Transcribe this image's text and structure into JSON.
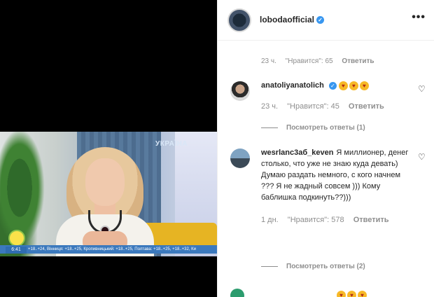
{
  "video": {
    "channel": "УКРАЇНА",
    "ticker": "+18..+24, Вінниця: +18..+25, Кропивницький: +18..+25, Полтава: +18..+25, +18..+32, Ки",
    "clock": "6:41"
  },
  "post": {
    "username": "lobodaofficial",
    "more_icon": "•••"
  },
  "top_meta": {
    "time": "23 ч.",
    "likes": "\"Нравится\": 65",
    "reply": "Ответить"
  },
  "comments": [
    {
      "username": "anatoliyanatolich",
      "text": "",
      "emojis": [
        "😍",
        "😍",
        "😍"
      ],
      "time": "23 ч.",
      "likes": "\"Нравится\": 45",
      "reply": "Ответить",
      "view_replies": "Посмотреть ответы (1)"
    },
    {
      "username": "wesrlanс3аб_keven",
      "text": "Я миллионер, денег столько, что уже не знаю куда девать) Думаю раздать немного, с кого начнем ??? Я не жадный совсем ))) Кому баблишка подкинуть??)))",
      "time": "1 дн.",
      "likes": "\"Нравится\": 578",
      "reply": "Ответить",
      "view_replies": "Посмотреть ответы (2)"
    }
  ],
  "colors": {
    "verified": "#3897f0",
    "muted": "#8e8e8e",
    "text": "#262626"
  }
}
